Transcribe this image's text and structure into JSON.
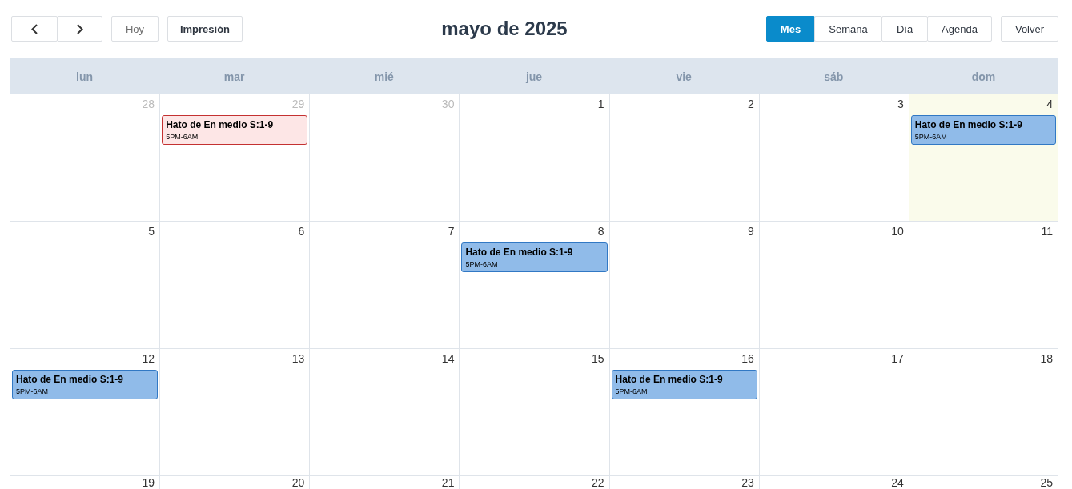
{
  "toolbar": {
    "today_button": {
      "label": "Hoy",
      "disabled": true
    },
    "print_button": {
      "label": "Impresión"
    },
    "title": "mayo de 2025",
    "views": [
      {
        "label": "Mes",
        "selected": true
      },
      {
        "label": "Semana",
        "selected": false
      },
      {
        "label": "Día",
        "selected": false
      },
      {
        "label": "Agenda",
        "selected": false
      }
    ],
    "back_button": {
      "label": "Volver"
    }
  },
  "weekdays": [
    "lun",
    "mar",
    "mié",
    "jue",
    "vie",
    "sáb",
    "dom"
  ],
  "weeks": [
    {
      "days": [
        {
          "number": "28",
          "other_month": true,
          "today": false
        },
        {
          "number": "29",
          "other_month": true,
          "today": false,
          "events": [
            {
              "title": "Hato de En medio S:1-9",
              "time": "5PM-6AM",
              "color": "#fde6e6"
            }
          ]
        },
        {
          "number": "30",
          "other_month": true,
          "today": false
        },
        {
          "number": "1",
          "other_month": false,
          "today": false
        },
        {
          "number": "2",
          "other_month": false,
          "today": false
        },
        {
          "number": "3",
          "other_month": false,
          "today": false
        },
        {
          "number": "4",
          "other_month": false,
          "today": true,
          "events": [
            {
              "title": "Hato de En medio S:1-9",
              "time": "5PM-6AM",
              "color": "#90bbe9"
            }
          ]
        }
      ]
    },
    {
      "days": [
        {
          "number": "5",
          "other_month": false,
          "today": false
        },
        {
          "number": "6",
          "other_month": false,
          "today": false
        },
        {
          "number": "7",
          "other_month": false,
          "today": false
        },
        {
          "number": "8",
          "other_month": false,
          "today": false,
          "events": [
            {
              "title": "Hato de En medio S:1-9",
              "time": "5PM-6AM",
              "color": "#90bbe9"
            }
          ]
        },
        {
          "number": "9",
          "other_month": false,
          "today": false
        },
        {
          "number": "10",
          "other_month": false,
          "today": false
        },
        {
          "number": "11",
          "other_month": false,
          "today": false
        }
      ]
    },
    {
      "days": [
        {
          "number": "12",
          "other_month": false,
          "today": false,
          "events": [
            {
              "title": "Hato de En medio S:1-9",
              "time": "5PM-6AM",
              "color": "#90bbe9"
            }
          ]
        },
        {
          "number": "13",
          "other_month": false,
          "today": false
        },
        {
          "number": "14",
          "other_month": false,
          "today": false
        },
        {
          "number": "15",
          "other_month": false,
          "today": false
        },
        {
          "number": "16",
          "other_month": false,
          "today": false,
          "events": [
            {
              "title": "Hato de En medio S:1-9",
              "time": "5PM-6AM",
              "color": "#90bbe9"
            }
          ]
        },
        {
          "number": "17",
          "other_month": false,
          "today": false
        },
        {
          "number": "18",
          "other_month": false,
          "today": false
        }
      ]
    },
    {
      "days": [
        {
          "number": "19",
          "other_month": false,
          "today": false
        },
        {
          "number": "20",
          "other_month": false,
          "today": false
        },
        {
          "number": "21",
          "other_month": false,
          "today": false
        },
        {
          "number": "22",
          "other_month": false,
          "today": false
        },
        {
          "number": "23",
          "other_month": false,
          "today": false
        },
        {
          "number": "24",
          "other_month": false,
          "today": false
        },
        {
          "number": "25",
          "other_month": false,
          "today": false
        }
      ]
    }
  ]
}
